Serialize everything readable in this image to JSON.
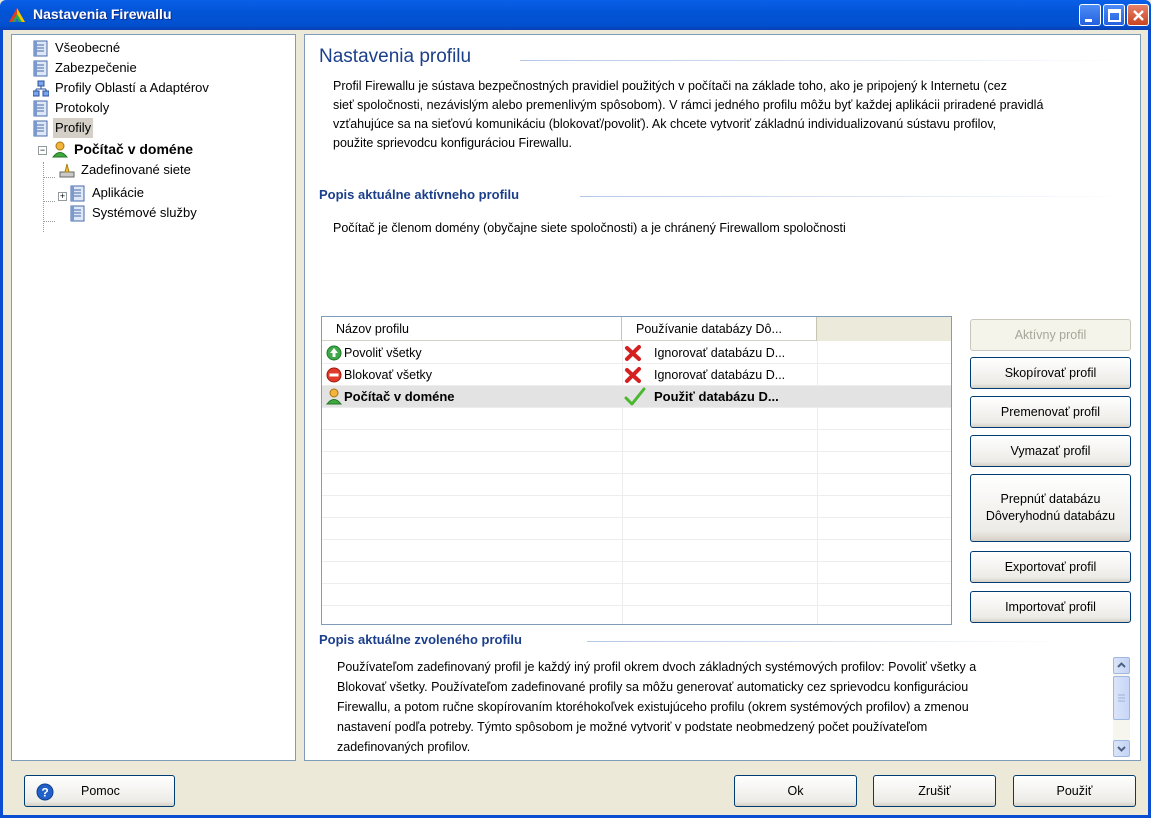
{
  "window": {
    "title": "Nastavenia Firewallu"
  },
  "tree": {
    "items": [
      {
        "label": "Všeobecné",
        "icon": "document-icon"
      },
      {
        "label": "Zabezpečenie",
        "icon": "document-icon"
      },
      {
        "label": "Profily Oblastí a Adaptérov",
        "icon": "network-icon"
      },
      {
        "label": "Protokoly",
        "icon": "document-icon"
      },
      {
        "label": "Profily",
        "icon": "document-icon"
      },
      {
        "label": "Počítač v doméne",
        "icon": "user-icon"
      },
      {
        "label": "Zadefinované siete",
        "icon": "network-drive-icon"
      },
      {
        "label": "Aplikácie",
        "icon": "document-icon"
      },
      {
        "label": "Systémové služby",
        "icon": "document-icon"
      }
    ]
  },
  "main": {
    "title": "Nastavenia profilu",
    "intro": "Profil Firewallu je sústava bezpečnostných pravidiel použitých v počítači na základe toho, ako je pripojený k Internetu (cez sieť spoločnosti, nezávislým alebo premenlivým spôsobom). V rámci jedného profilu môžu byť každej aplikácii priradené pravidlá vzťahujúce sa na sieťovú komunikáciu (blokovať/povoliť). Ak chcete vytvoriť základnú individualizovanú sústavu profilov, použite sprievodcu konfiguráciou Firewallu.",
    "intro_lines": [
      "Profil Firewallu je sústava bezpečnostných pravidiel použitých v počítači na základe toho, ako je pripojený k Internetu (cez",
      "sieť spoločnosti, nezávislým alebo premenlivým spôsobom). V rámci jedného profilu môžu byť každej aplikácii priradené pravidlá",
      "vzťahujúce sa na sieťovú komunikáciu (blokovať/povoliť). Ak chcete vytvoriť základnú individualizovanú sústavu profilov,",
      "použite sprievodcu konfiguráciou Firewallu."
    ],
    "active_heading": "Popis aktuálne aktívneho profilu",
    "active_desc": "Počítač je členom domény (obyčajne siete spoločnosti) a je chránený Firewallom spoločnosti",
    "table": {
      "columns": [
        "Názov profilu",
        "Používanie databázy Dô..."
      ],
      "rows": [
        {
          "name": "Povoliť všetky",
          "db": "Ignorovať databázu D...",
          "icon": "green-up-icon",
          "db_icon": "red-x-icon"
        },
        {
          "name": "Blokovať všetky",
          "db": "Ignorovať databázu D...",
          "icon": "red-stop-icon",
          "db_icon": "red-x-icon"
        },
        {
          "name": "Počítač v doméne",
          "db": "Použiť databázu D...",
          "icon": "user-icon",
          "db_icon": "green-check-icon"
        }
      ]
    },
    "buttons": {
      "active": "Aktívny profil",
      "copy": "Skopírovať profil",
      "rename": "Premenovať profil",
      "delete": "Vymazať profil",
      "switch_line1": "Prepnúť databázu",
      "switch_line2": "Dôveryhodnú databázu",
      "export": "Exportovať profil",
      "import": "Importovať profil"
    },
    "selected_heading": "Popis aktuálne zvoleného profilu",
    "selected_lines": [
      "Používateľom zadefinovaný profil je každý iný profil okrem dvoch základných systémových profilov: Povoliť všetky a",
      "Blokovať všetky. Používateľom zadefinované profily sa môžu generovať automaticky cez sprievodcu konfiguráciou",
      "Firewallu, a potom ručne skopírovaním ktoréhokoľvek existujúceho profilu (okrem systémových profilov) a zmenou",
      "nastavení podľa potreby. Týmto spôsobom je možné vytvoriť v podstate neobmedzený počet používateľom",
      "zadefinovaných profilov."
    ]
  },
  "footer": {
    "help": "Pomoc",
    "ok": "Ok",
    "cancel": "Zrušiť",
    "apply": "Použiť"
  }
}
